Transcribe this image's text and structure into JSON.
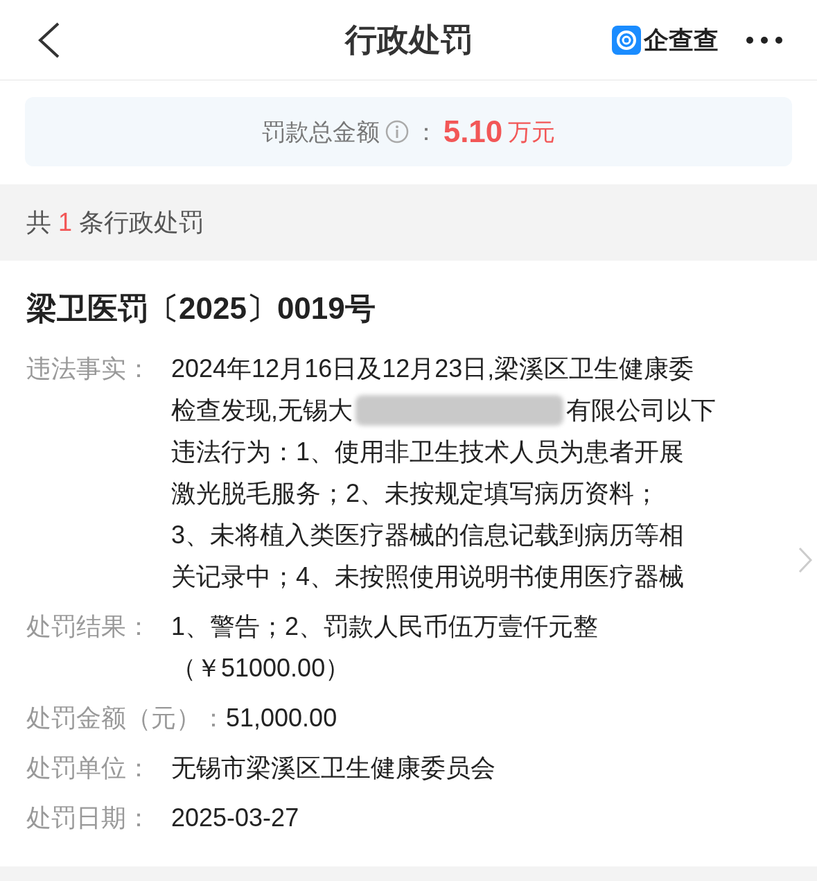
{
  "header": {
    "title": "行政处罚",
    "brand": "企查查"
  },
  "summary": {
    "label": "罚款总金额",
    "separator": "：",
    "amount": "5.10",
    "unit": "万元"
  },
  "count": {
    "prefix": "共",
    "number": "1",
    "suffix": "条行政处罚"
  },
  "record": {
    "title": "梁卫医罚〔2025〕0019号",
    "fields": [
      {
        "label": "违法事实：",
        "lines": [
          {
            "kind": "text",
            "text": "2024年12月16日及12月23日,梁溪区卫生健康委"
          },
          {
            "kind": "redacted",
            "parts": [
              "检查发现,无锡大",
              "有限公司以下"
            ]
          },
          {
            "kind": "text",
            "text": "违法行为：1、使用非卫生技术人员为患者开展"
          },
          {
            "kind": "text",
            "text": "激光脱毛服务；2、未按规定填写病历资料；"
          },
          {
            "kind": "text",
            "text": "3、未将植入类医疗器械的信息记载到病历等相"
          },
          {
            "kind": "text",
            "text": "关记录中；4、未按照使用说明书使用医疗器械"
          }
        ]
      },
      {
        "label": "处罚结果：",
        "lines": [
          {
            "kind": "text",
            "text": "1、警告；2、罚款人民币伍万壹仟元整"
          },
          {
            "kind": "text",
            "text": "（￥51000.00）"
          }
        ]
      },
      {
        "label": "处罚金额（元）：",
        "lines": [
          {
            "kind": "text",
            "text": "51,000.00"
          }
        ]
      },
      {
        "label": "处罚单位：",
        "lines": [
          {
            "kind": "text",
            "text": "无锡市梁溪区卫生健康委员会"
          }
        ]
      },
      {
        "label": "处罚日期：",
        "lines": [
          {
            "kind": "text",
            "text": "2025-03-27"
          }
        ]
      }
    ]
  }
}
